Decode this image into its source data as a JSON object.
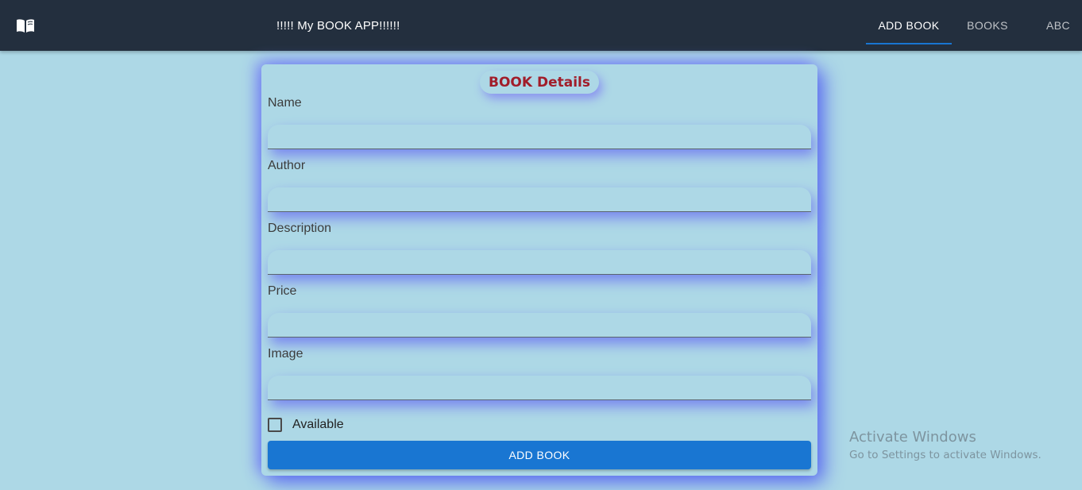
{
  "header": {
    "logo_icon": "menu-book-icon",
    "title": "!!!!! My BOOK APP!!!!!!",
    "tabs": [
      {
        "label": "ADD BOOK",
        "active": true
      },
      {
        "label": "BOOKS",
        "active": false
      },
      {
        "label": "ABC",
        "active": false
      }
    ],
    "accent_color": "#1976d2",
    "background_color": "#232f3e"
  },
  "form": {
    "title": "BOOK Details",
    "fields": [
      {
        "label": "Name",
        "value": ""
      },
      {
        "label": "Author",
        "value": ""
      },
      {
        "label": "Description",
        "value": ""
      },
      {
        "label": "Price",
        "value": ""
      },
      {
        "label": "Image",
        "value": ""
      }
    ],
    "checkbox": {
      "label": "Available",
      "checked": false
    },
    "submit_label": "ADD BOOK"
  },
  "watermark": {
    "title": "Activate Windows",
    "subtitle": "Go to Settings to activate Windows."
  }
}
